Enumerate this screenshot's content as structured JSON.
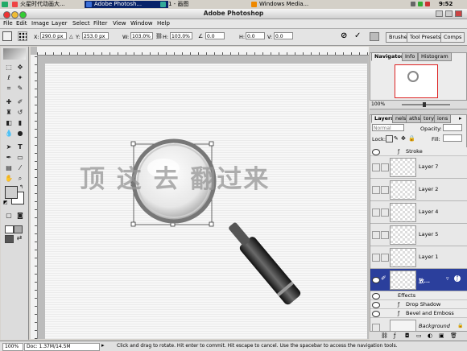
{
  "taskbar": {
    "items": [
      {
        "label": "火星时代动画大..."
      },
      {
        "label": "Adobe Photosh..."
      },
      {
        "label": "1 - 画图"
      },
      {
        "label": "Windows Media..."
      }
    ],
    "clock": "9:52"
  },
  "window": {
    "title": "Adobe Photoshop"
  },
  "menu": [
    "File",
    "Edit",
    "Image",
    "Layer",
    "Select",
    "Filter",
    "View",
    "Window",
    "Help"
  ],
  "options": {
    "x_label": "X:",
    "x_value": "290.0 px",
    "y_label": "Y:",
    "y_value": "253.0 px",
    "w_label": "W:",
    "w_value": "103.0%",
    "h_label": "H:",
    "h_value": "103.0%",
    "angle_value": "0.0",
    "hskew_label": "H:",
    "hskew_value": "0.0",
    "vskew_label": "V:",
    "vskew_value": "0.0",
    "wells": [
      "Brushes",
      "Tool Presets",
      "Comps"
    ]
  },
  "canvas": {
    "watermark": "顶 这 去 翻过来"
  },
  "panels": {
    "navigator_tabs": [
      "Navigator",
      "Info",
      "Histogram"
    ],
    "zoom": "100%",
    "layer_tabs": [
      "Layers",
      "nels",
      "aths",
      "tory",
      "ions"
    ],
    "blend_mode": "Normal",
    "opacity_label": "Opacity:",
    "lock_label": "Lock:",
    "fill_label": "Fill:",
    "stroke_label": "Stroke",
    "layers": [
      "Layer 7",
      "Layer 2",
      "Layer 4",
      "Layer 5",
      "Layer 1"
    ],
    "selected_layer": "放...",
    "effects_label": "Effects",
    "effects": [
      "Drop Shadow",
      "Bevel and Emboss"
    ],
    "background_label": "Background"
  },
  "status": {
    "zoom": "100%",
    "doc": "Doc: 1.37M/14.5M",
    "hint": "Click and drag to rotate. Hit enter to commit. Hit escape to cancel. Use the spacebar to access the navigation tools."
  },
  "colors": {
    "selection": "#2b3f9c",
    "taskbar_active": "#0a246a"
  }
}
